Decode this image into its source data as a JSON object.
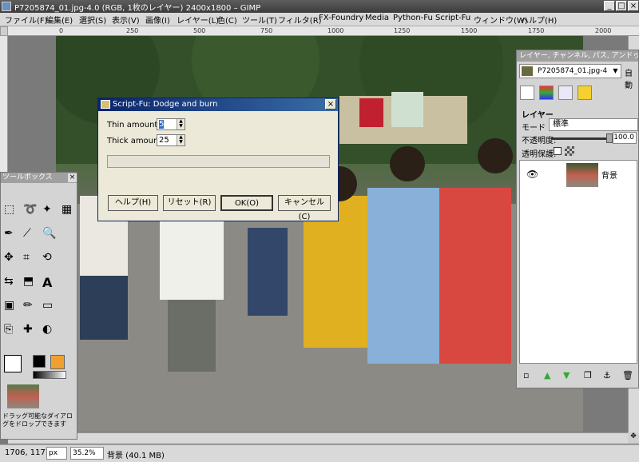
{
  "window": {
    "title": "P7205874_01.jpg-4.0 (RGB, 1枚のレイヤー) 2400x1800 – GIMP",
    "controls": [
      "_",
      "□",
      "×"
    ]
  },
  "menubar": [
    "ファイル(F)",
    "編集(E)",
    "選択(S)",
    "表示(V)",
    "画像(I)",
    "レイヤー(L)",
    "色(C)",
    "ツール(T)",
    "フィルタ(R)",
    "FX-Foundry",
    "Media",
    "Python-Fu",
    "Script-Fu",
    "ウィンドウ(W)",
    "ヘルプ(H)"
  ],
  "ruler": {
    "ticks": [
      "0",
      "250",
      "500",
      "750",
      "1000",
      "1250",
      "1500",
      "1750",
      "2000"
    ]
  },
  "layers_dock": {
    "tabs_title": "レイヤー, チャンネル, パス, アンドゥ",
    "image_select": "P7205874_01.jpg-4",
    "auto_label": "自動",
    "section_title": "レイヤー",
    "mode_label": "モード",
    "mode_value": "標準",
    "opacity_label": "不透明度:",
    "opacity_value": "100.0",
    "lock_label": "透明保護:",
    "layer_name": "背景"
  },
  "toolbox": {
    "title": "ツールボックス",
    "drop_hint": "ドラッグ可能なダイアログをドロップできます"
  },
  "statusbar": {
    "coords": "1706, 1177",
    "unit": "px",
    "zoom": "35.2%",
    "info": "背景 (40.1 MB)"
  },
  "dialog": {
    "title": "Script-Fu: Dodge and burn",
    "thin_label": "Thin amount:",
    "thin_value": "5",
    "thick_label": "Thick amount:",
    "thick_value": "25",
    "buttons": {
      "help": "ヘルプ(H)",
      "reset": "リセット(R)",
      "ok": "OK(O)",
      "cancel": "キャンセル(C)"
    }
  }
}
